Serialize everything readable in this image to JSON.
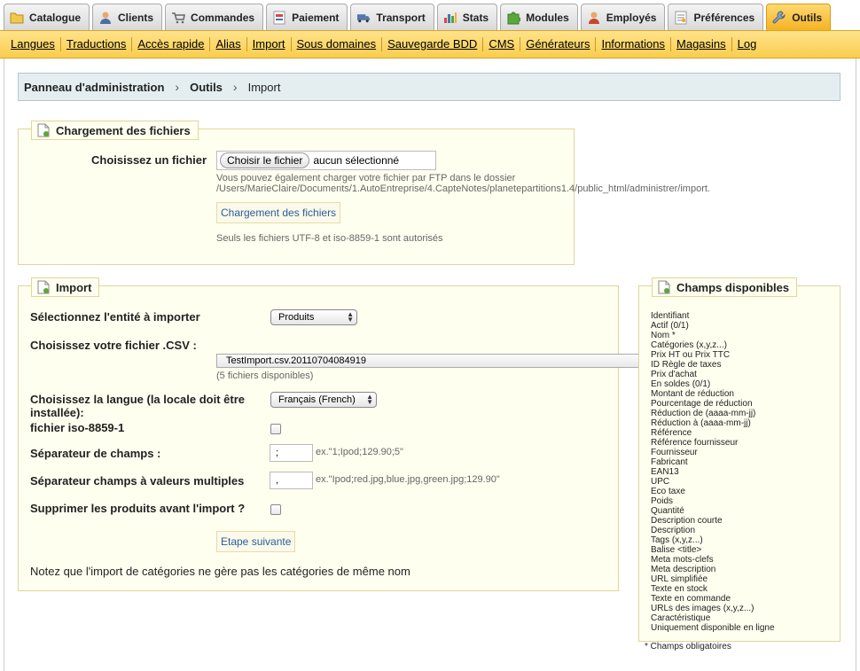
{
  "tabs": [
    {
      "label": "Catalogue",
      "icon": "folder-icon"
    },
    {
      "label": "Clients",
      "icon": "user-icon"
    },
    {
      "label": "Commandes",
      "icon": "cart-icon"
    },
    {
      "label": "Paiement",
      "icon": "payment-icon"
    },
    {
      "label": "Transport",
      "icon": "truck-icon"
    },
    {
      "label": "Stats",
      "icon": "chart-icon"
    },
    {
      "label": "Modules",
      "icon": "puzzle-icon"
    },
    {
      "label": "Employés",
      "icon": "employee-icon"
    },
    {
      "label": "Préférences",
      "icon": "preferences-icon"
    },
    {
      "label": "Outils",
      "icon": "wrench-icon",
      "active": true
    }
  ],
  "subnav": [
    "Langues",
    "Traductions",
    "Accès rapide",
    "Alias",
    "Import",
    "Sous domaines",
    "Sauvegarde BDD",
    "CMS",
    "Générateurs",
    "Informations",
    "Magasins",
    "Log"
  ],
  "breadcrumb": {
    "root": "Panneau d'administration",
    "section": "Outils",
    "current": "Import"
  },
  "upload": {
    "legend": "Chargement des fichiers",
    "choose_label": "Choisissez un fichier",
    "file_button": "Choisir le fichier",
    "file_status": "aucun sélectionné",
    "ftp_note": "Vous pouvez également charger votre fichier par FTP dans le dossier",
    "ftp_path": "/Users/MarieClaire/Documents/1.AutoEntreprise/4.CapteNotes/planetepartitions1.4/public_html/administrer/import.",
    "submit": "Chargement des fichiers",
    "formats_note": "Seuls les fichiers UTF-8 et iso-8859-1 sont autorisés"
  },
  "import": {
    "legend": "Import",
    "entity_label": "Sélectionnez l'entité à importer",
    "entity_value": "Produits",
    "csv_label": "Choisissez votre fichier .CSV :",
    "csv_value": "TestImport.csv.20110704084919",
    "csv_count": "(5 fichiers disponibles)",
    "lang_label_1": "Choisissez la langue (la locale doit être",
    "lang_label_2": "installée):",
    "lang_value": "Français (French)",
    "iso_label": "fichier iso-8859-1",
    "sep_label": "Séparateur de champs :",
    "sep_value": ";",
    "sep_example": "ex.\"1;Ipod;129.90;5\"",
    "multi_label": "Séparateur champs à valeurs multiples",
    "multi_value": ",",
    "multi_example": "ex.\"Ipod;red.jpg,blue.jpg,green.jpg;129.90\"",
    "delete_label": "Supprimer les produits avant l'import ?",
    "next_button": "Etape suivante",
    "note": "Notez que l'import de catégories ne gère pas les catégories de même nom"
  },
  "fields": {
    "legend": "Champs disponibles",
    "items": [
      "Identifiant",
      "Actif (0/1)",
      "Nom *",
      "Catégories (x,y,z...)",
      "Prix HT ou Prix TTC",
      "ID Règle de taxes",
      "Prix d'achat",
      "En soldes (0/1)",
      "Montant de réduction",
      "Pourcentage de réduction",
      "Réduction de (aaaa-mm-jj)",
      "Réduction à (aaaa-mm-jj)",
      "Référence",
      "Référence fournisseur",
      "Fournisseur",
      "Fabricant",
      "EAN13",
      "UPC",
      "Eco taxe",
      "Poids",
      "Quantité",
      "Description courte",
      "Description",
      "Tags (x,y,z...)",
      "Balise <title>",
      "Meta mots-clefs",
      "Meta description",
      "URL simplifiée",
      "Texte en stock",
      "Texte en commande",
      "URLs des images (x,y,z...)",
      "Caractéristique",
      "Uniquement disponible en ligne"
    ],
    "required_note": "* Champs obligatoires"
  }
}
